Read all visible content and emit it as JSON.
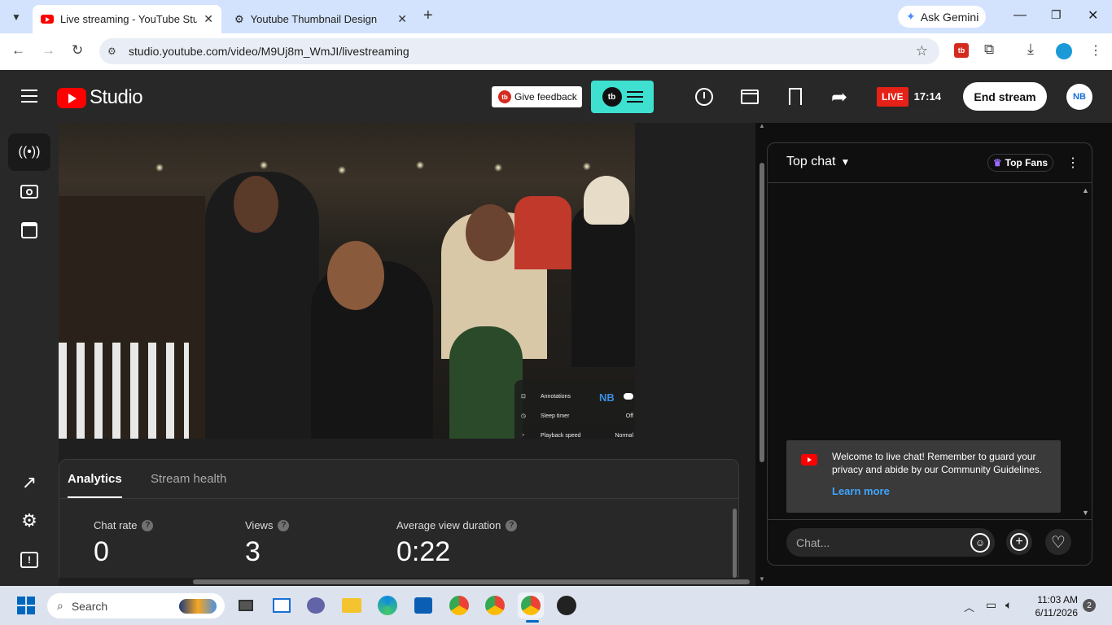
{
  "browser": {
    "tabs": [
      {
        "title": "Live streaming - YouTube Studio",
        "active": true
      },
      {
        "title": "Youtube Thumbnail Design",
        "active": false
      }
    ],
    "new_tab": "+",
    "gemini_label": "Ask Gemini",
    "url": "studio.youtube.com/video/M9Uj8m_WmJI/livestreaming"
  },
  "studio": {
    "logo_text": "Studio",
    "feedback_label": "Give feedback",
    "live_badge": "LIVE",
    "live_time": "17:14",
    "end_stream_label": "End stream"
  },
  "video": {
    "settings_menu": [
      {
        "label": "Annotations",
        "value": ""
      },
      {
        "label": "Sleep timer",
        "value": "Off"
      },
      {
        "label": "Playback speed",
        "value": "Normal"
      }
    ]
  },
  "panel": {
    "tabs": [
      "Analytics",
      "Stream health"
    ],
    "metrics": [
      {
        "label": "Chat rate",
        "value": "0"
      },
      {
        "label": "Views",
        "value": "3"
      },
      {
        "label": "Average view duration",
        "value": "0:22"
      }
    ]
  },
  "chat": {
    "title": "Top chat",
    "top_fans_label": "Top Fans",
    "welcome_text": "Welcome to live chat! Remember to guard your privacy and abide by our Community Guidelines.",
    "learn_more": "Learn more",
    "input_placeholder": "Chat..."
  },
  "taskbar": {
    "search_placeholder": "Search",
    "time": "11:03 AM",
    "date": "6/11/2026",
    "notification_count": "2"
  },
  "colors": {
    "accent_cyan": "#3ee0d0",
    "live_red": "#e62117",
    "link_blue": "#3ea6ff"
  }
}
